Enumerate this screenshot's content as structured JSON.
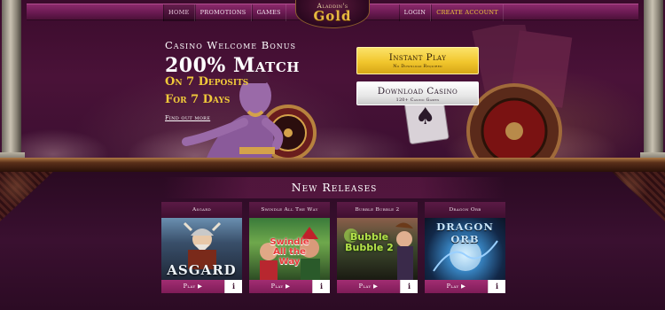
{
  "nav": {
    "left_items": [
      "Home",
      "Promotions",
      "Games"
    ],
    "right_items": [
      "Login",
      "Create Account"
    ]
  },
  "logo": {
    "line1": "Aladdin's",
    "line2": "Gold"
  },
  "promo": {
    "title": "Casino Welcome Bonus",
    "match": "200% Match",
    "deposits": "On 7 Deposits",
    "days": "For 7 Days",
    "link": "Find out more"
  },
  "cta": {
    "instant_label": "Instant Play",
    "instant_sub": "No Download Required",
    "download_label": "Download Casino",
    "download_sub": "120+ Casino Games"
  },
  "releases": {
    "title": "New Releases",
    "games": [
      {
        "name": "Asgard",
        "thumb_text": "ASGARD"
      },
      {
        "name": "Swindle All The Way",
        "thumb_text": "Swindle All the Way"
      },
      {
        "name": "Bubble Bubble 2",
        "thumb_text": "Bubble Bubble 2"
      },
      {
        "name": "Dragon Orb",
        "thumb_text": "DRAGON ORB"
      }
    ],
    "play_label": "Play ▶",
    "info_label": "i"
  },
  "colors": {
    "accent_gold": "#f0c93a",
    "play_button": "#a22d73",
    "background": "#3a0b2c"
  }
}
